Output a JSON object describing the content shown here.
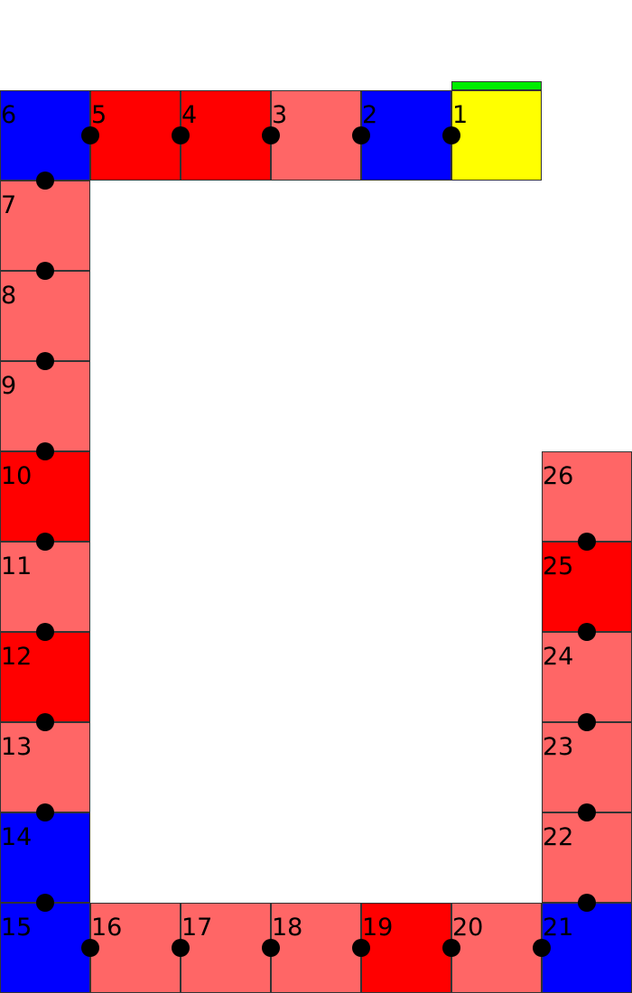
{
  "colors": {
    "yellow": "#ffff00",
    "blue": "#0000ff",
    "red": "#ff0000",
    "light_red": "#ff6666",
    "green": "#00ee00",
    "dot": "#000000"
  },
  "start_marker_color": "green",
  "cells": [
    {
      "label": "1",
      "color": "yellow"
    },
    {
      "label": "2",
      "color": "blue"
    },
    {
      "label": "3",
      "color": "light_red"
    },
    {
      "label": "4",
      "color": "red"
    },
    {
      "label": "5",
      "color": "red"
    },
    {
      "label": "6",
      "color": "blue"
    },
    {
      "label": "7",
      "color": "light_red"
    },
    {
      "label": "8",
      "color": "light_red"
    },
    {
      "label": "9",
      "color": "light_red"
    },
    {
      "label": "10",
      "color": "red"
    },
    {
      "label": "11",
      "color": "light_red"
    },
    {
      "label": "12",
      "color": "red"
    },
    {
      "label": "13",
      "color": "light_red"
    },
    {
      "label": "14",
      "color": "blue"
    },
    {
      "label": "15",
      "color": "blue"
    },
    {
      "label": "16",
      "color": "light_red"
    },
    {
      "label": "17",
      "color": "light_red"
    },
    {
      "label": "18",
      "color": "light_red"
    },
    {
      "label": "19",
      "color": "red"
    },
    {
      "label": "20",
      "color": "light_red"
    },
    {
      "label": "21",
      "color": "blue"
    },
    {
      "label": "22",
      "color": "light_red"
    },
    {
      "label": "23",
      "color": "light_red"
    },
    {
      "label": "24",
      "color": "light_red"
    },
    {
      "label": "25",
      "color": "red"
    },
    {
      "label": "26",
      "color": "light_red"
    }
  ]
}
